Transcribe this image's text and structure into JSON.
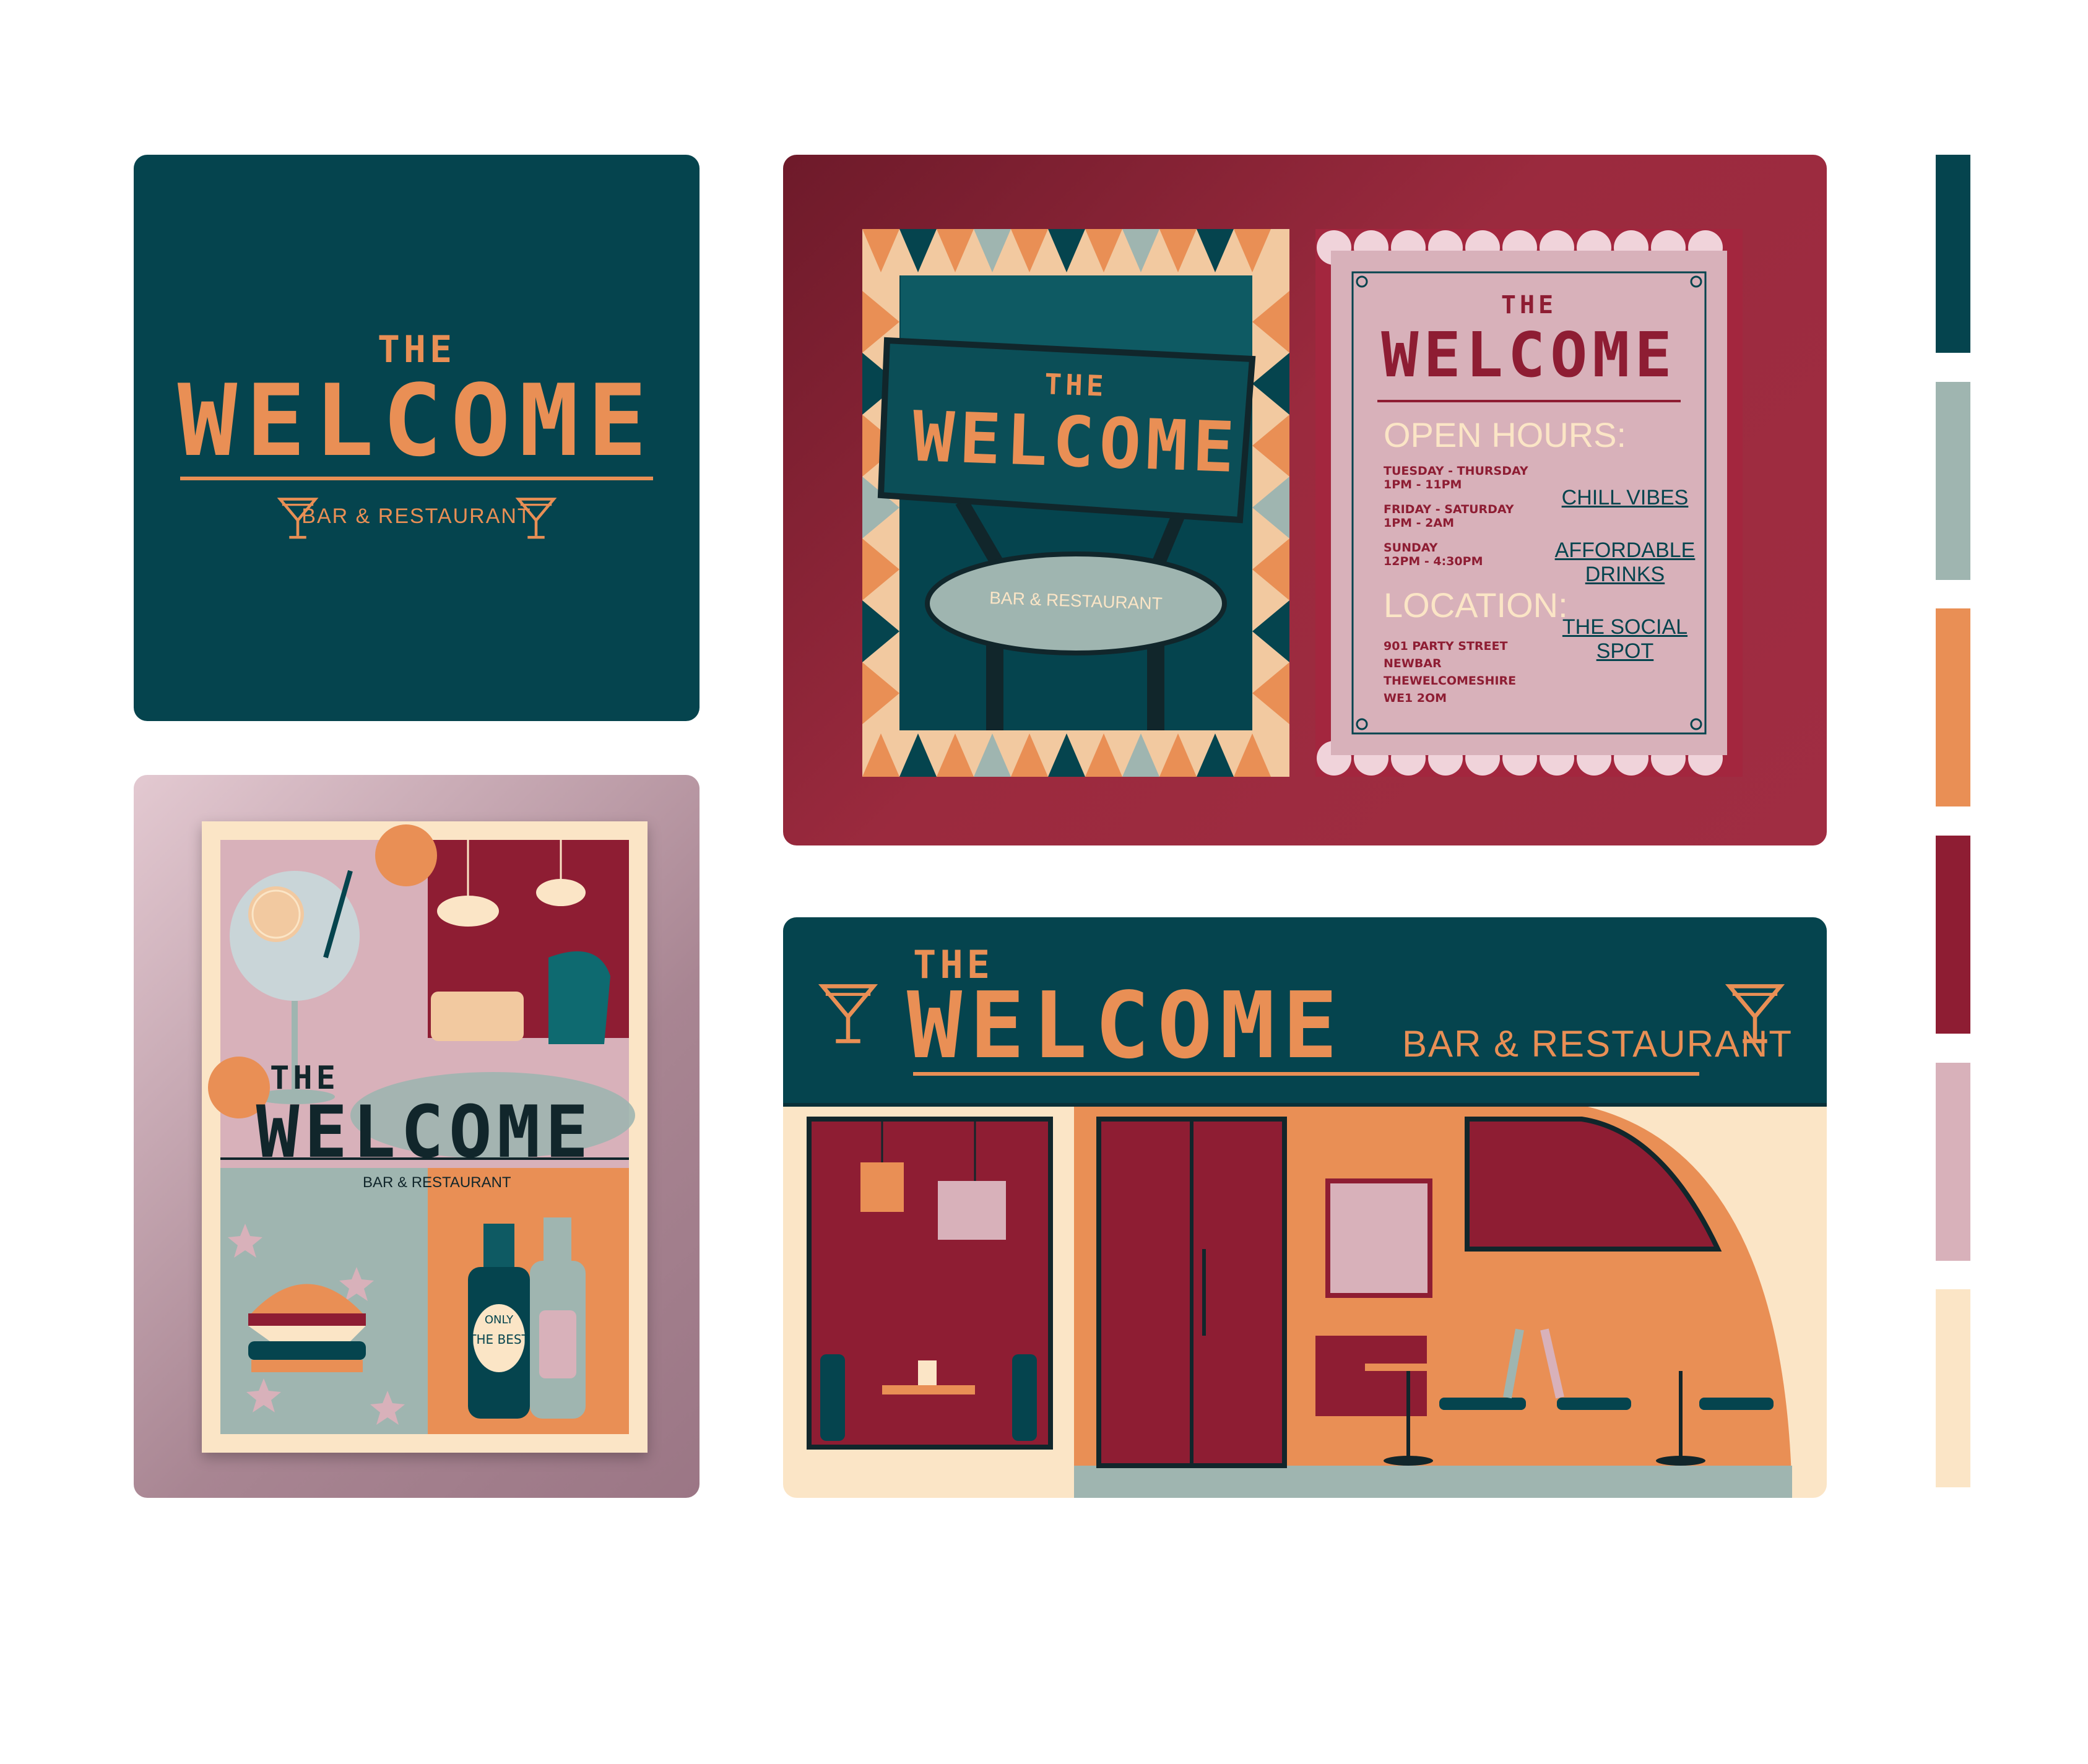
{
  "brand": {
    "the": "THE",
    "name": "WELCOME",
    "tagline": "BAR & RESTAURANT"
  },
  "hours_poster": {
    "open_hours_heading": "OPEN HOURS:",
    "hours": [
      {
        "days": "TUESDAY - THURSDAY",
        "time": "1PM - 11PM"
      },
      {
        "days": "FRIDAY - SATURDAY",
        "time": "1PM - 2AM"
      },
      {
        "days": "SUNDAY",
        "time": "12PM - 4:30PM"
      }
    ],
    "location_heading": "LOCATION:",
    "address": [
      "901 PARTY STREET",
      "NEWBAR",
      "THEWELCOMESHIRE",
      "WE1 2OM"
    ],
    "features": [
      "CHILL VIBES",
      "AFFORDABLE DRINKS",
      "THE SOCIAL SPOT"
    ]
  },
  "food_poster": {
    "bottle_label_top": "ONLY",
    "bottle_label_bottom": "THE BEST"
  },
  "palette": {
    "teal": "#05444e",
    "sage": "#9fb5b0",
    "orange": "#e98f55",
    "crimson": "#8e1d33",
    "mauve": "#d8b1ba",
    "cream": "#fbe5c6"
  },
  "icons": [
    "cocktail-glass-icon"
  ]
}
